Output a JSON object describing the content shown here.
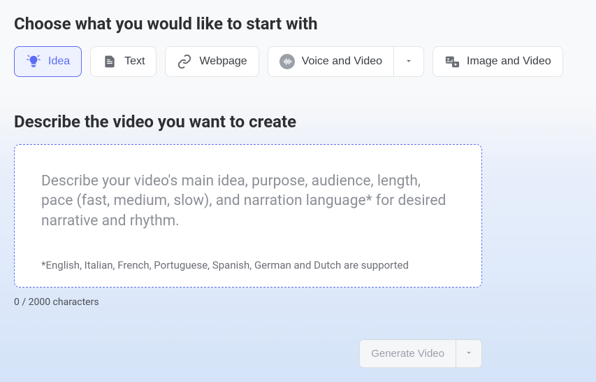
{
  "header": {
    "title": "Choose what you would like to start with"
  },
  "tabs": {
    "idea": "Idea",
    "text": "Text",
    "webpage": "Webpage",
    "voiceVideo": "Voice and Video",
    "imageVideo": "Image and Video"
  },
  "describe": {
    "title": "Describe the video you want to create",
    "placeholder": "Describe your video's main idea, purpose, audience, length, pace (fast, medium, slow), and narration language* for desired narrative and rhythm.",
    "note": "*English, Italian, French, Portuguese, Spanish, German and Dutch are supported",
    "charCount": "0 / 2000 characters"
  },
  "actions": {
    "generate": "Generate Video"
  }
}
